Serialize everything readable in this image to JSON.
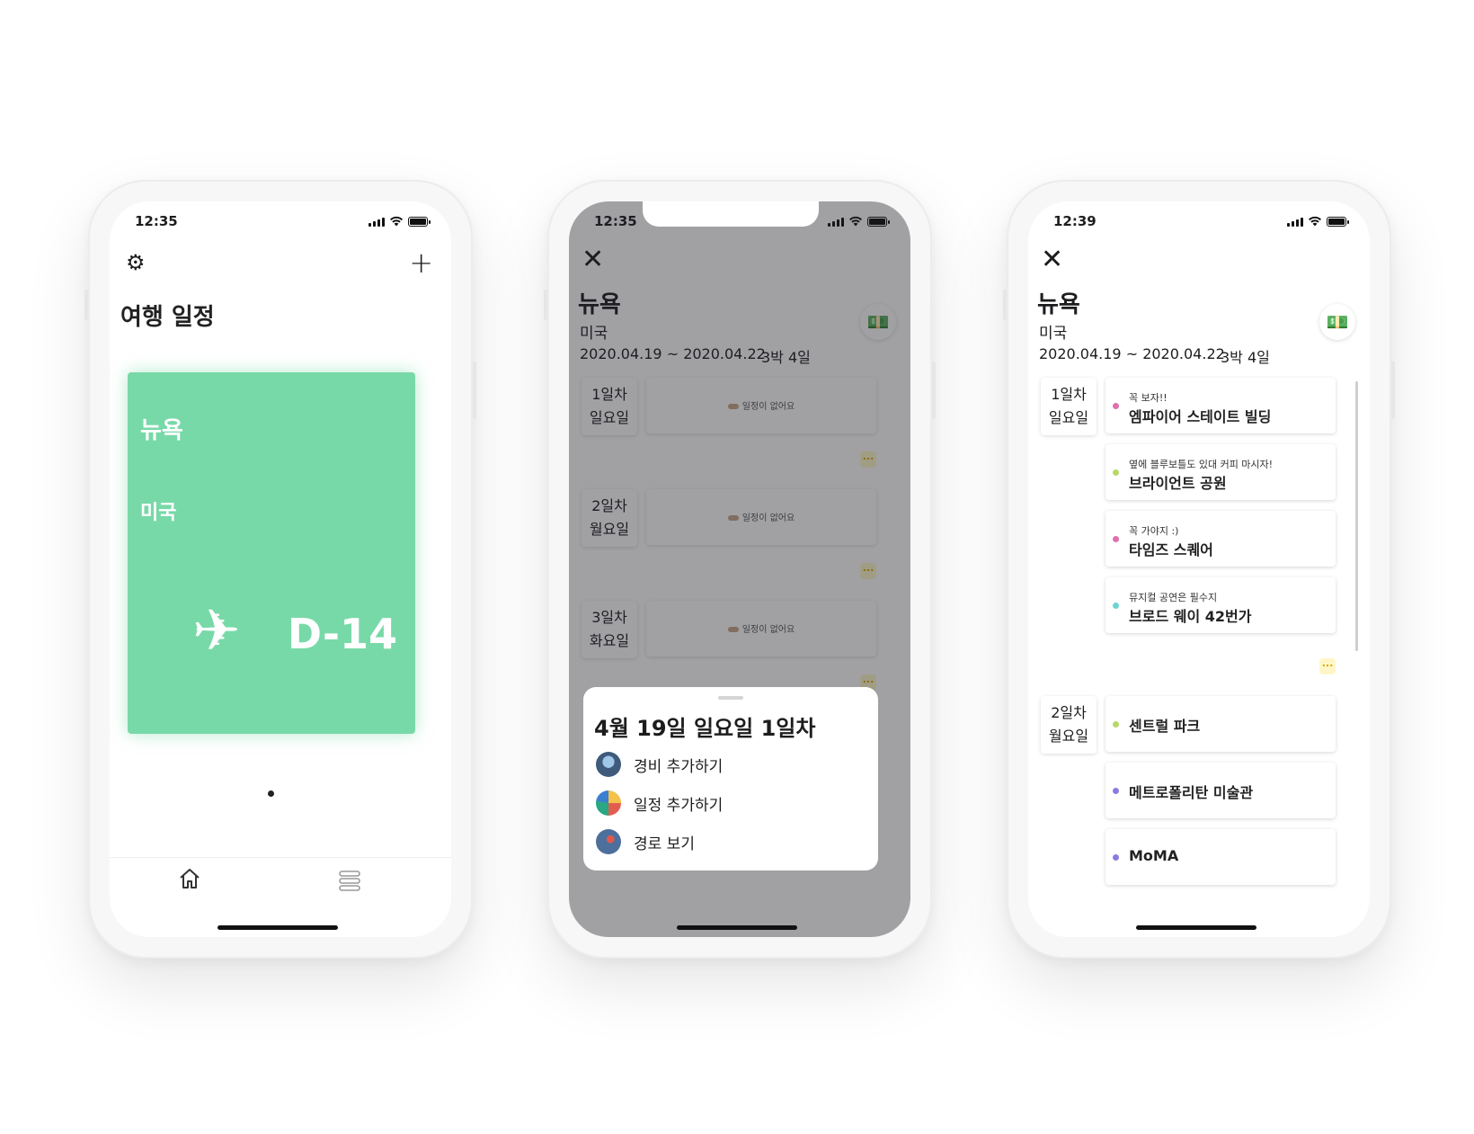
{
  "phone1": {
    "time": "12:35",
    "title": "여행 일정",
    "trip_card": {
      "city": "뉴욕",
      "country": "미국",
      "dday": "D-14",
      "color": "#78d9a8"
    },
    "icons": {
      "settings": "gear-icon",
      "add": "plus-icon",
      "plane": "airplane-icon",
      "home": "home-icon",
      "list": "list-icon"
    }
  },
  "phone2": {
    "time": "12:35",
    "city": "뉴욕",
    "country": "미국",
    "dates": "2020.04.19 ~ 2020.04.22",
    "nights": "3박 4일",
    "days": [
      {
        "day": "1일차",
        "weekday": "일요일",
        "empty": "일정이 없어요"
      },
      {
        "day": "2일차",
        "weekday": "월요일",
        "empty": "일정이 없어요"
      },
      {
        "day": "3일차",
        "weekday": "화요일",
        "empty": "일정이 없어요"
      }
    ],
    "more": "...",
    "sheet": {
      "title": "4월 19일 일요일 1일차",
      "actions": [
        {
          "label": "경비 추가하기",
          "icon": "expense-icon"
        },
        {
          "label": "일정 추가하기",
          "icon": "schedule-icon"
        },
        {
          "label": "경로 보기",
          "icon": "route-icon"
        }
      ]
    }
  },
  "phone3": {
    "time": "12:39",
    "city": "뉴욕",
    "country": "미국",
    "dates": "2020.04.19 ~ 2020.04.22",
    "nights": "3박 4일",
    "more": "...",
    "day1": {
      "day": "1일차",
      "weekday": "일요일",
      "items": [
        {
          "memo": "꼭 보자!!",
          "name": "엠파이어 스테이트 빌딩",
          "color": "#e06fae"
        },
        {
          "memo": "옆에 블루보틀도 있대 커피 마시자!",
          "name": "브라이언트 공원",
          "color": "#b7d86a"
        },
        {
          "memo": "꼭 가야지 :)",
          "name": "타임즈 스퀘어",
          "color": "#e06fae"
        },
        {
          "memo": "뮤지컬 공연은 필수지",
          "name": "브로드 웨이 42번가",
          "color": "#6fd3d3"
        }
      ]
    },
    "day2": {
      "day": "2일차",
      "weekday": "월요일",
      "items": [
        {
          "name": "센트럴 파크",
          "color": "#b7d86a"
        },
        {
          "name": "메트로폴리탄 미술관",
          "color": "#8d7ae0"
        },
        {
          "name": "MoMA",
          "color": "#8d7ae0"
        }
      ]
    }
  }
}
